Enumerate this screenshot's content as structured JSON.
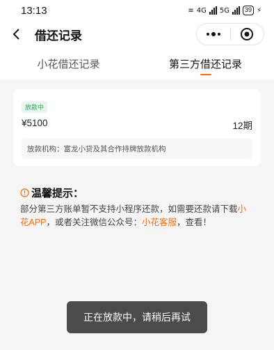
{
  "status_bar": {
    "time": "13:13",
    "network_1": "4G",
    "network_2": "5G",
    "battery": "39"
  },
  "nav": {
    "title": "借还记录",
    "back_icon": "chevron-left-icon",
    "more_icon": "more-dots-icon",
    "close_icon": "target-circle-icon"
  },
  "tabs": [
    {
      "label": "小花借还记录",
      "active": false
    },
    {
      "label": "第三方借还记录",
      "active": true
    }
  ],
  "record": {
    "status": "放款中",
    "amount": "¥5100",
    "periods": "12期",
    "institution": "放款机构：富龙小贷及其合作持牌放款机构"
  },
  "tip": {
    "icon": "warning-circle-icon",
    "title": "温馨提示：",
    "body_1": "部分第三方账单暂不支持小程序还款，如需要还款请下载",
    "link_app": "小花APP",
    "body_2": "，或者关注微信公众号：",
    "link_service": "小花客服",
    "body_3": "，查看！"
  },
  "toast": {
    "message": "正在放款中，请稍后再试"
  },
  "colors": {
    "accent": "#ff6a00",
    "status_green": "#1ab24a",
    "toast_bg": "#3c3c3c"
  }
}
